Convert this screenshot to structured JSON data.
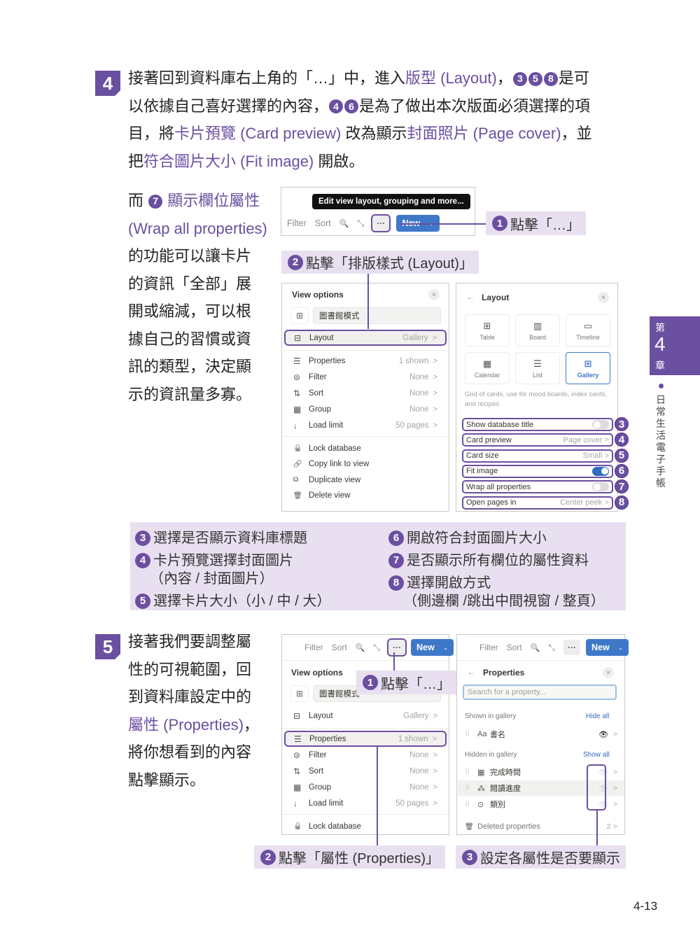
{
  "step4": {
    "badge": "4",
    "lines": [
      [
        {
          "t": "接著回到資料庫右上角的「…」中，進入"
        },
        {
          "t": "版型 (Layout)",
          "c": "purple"
        },
        {
          "t": "，"
        },
        {
          "n": "3"
        },
        {
          "n": "5"
        },
        {
          "n": "8"
        },
        {
          "t": "是可"
        }
      ],
      [
        {
          "t": "以依據自己喜好選擇的內容，"
        },
        {
          "n": "4"
        },
        {
          "n": "6"
        },
        {
          "t": "是為了做出本次版面必須選擇的項"
        }
      ],
      [
        {
          "t": "目，將"
        },
        {
          "t": "卡片預覽 (Card preview)",
          "c": "purple"
        },
        {
          "t": " 改為顯示"
        },
        {
          "t": "封面照片 (Page cover)",
          "c": "purple"
        },
        {
          "t": "，並"
        }
      ],
      [
        {
          "t": "把"
        },
        {
          "t": "符合圖片大小 (Fit image)",
          "c": "purple"
        },
        {
          "t": " 開啟。"
        }
      ]
    ]
  },
  "side_note": {
    "lines": [
      [
        {
          "t": "而 "
        },
        {
          "n": "7"
        },
        {
          "t": " 顯示欄位屬性",
          "c": "purple"
        }
      ],
      [
        {
          "t": "(Wrap all properties)",
          "c": "purple"
        }
      ],
      [
        {
          "t": "的功能可以讓卡片"
        }
      ],
      [
        {
          "t": "的資訊「全部」展"
        }
      ],
      [
        {
          "t": "開或縮減，可以根"
        }
      ],
      [
        {
          "t": "據自己的習慣或資"
        }
      ],
      [
        {
          "t": "訊的類型，決定顯"
        }
      ],
      [
        {
          "t": "示的資訊量多寡。"
        }
      ]
    ]
  },
  "toolbar": {
    "filter": "Filter",
    "sort": "Sort",
    "search_icon": "🔍",
    "expand_icon": "⤡",
    "more": "···",
    "new": "New",
    "new_chevron": "⌄",
    "tooltip": "Edit view layout, grouping and more..."
  },
  "callouts_top": {
    "c1": {
      "num": "1",
      "text": "點擊「…」"
    },
    "c2": {
      "num": "2",
      "text": "點擊「排版樣式 (Layout)」"
    }
  },
  "view_options": {
    "title": "View options",
    "close": "×",
    "view_name": "圖書館模式",
    "view_icon": "⊞",
    "items": [
      {
        "icon": "⊟",
        "label": "Layout",
        "value": "Gallery"
      },
      {
        "icon": "☰",
        "label": "Properties",
        "value": "1 shown"
      },
      {
        "icon": "⊜",
        "label": "Filter",
        "value": "None"
      },
      {
        "icon": "⇅",
        "label": "Sort",
        "value": "None"
      },
      {
        "icon": "▦",
        "label": "Group",
        "value": "None"
      },
      {
        "icon": "↓",
        "label": "Load limit",
        "value": "50 pages"
      }
    ],
    "actions": [
      {
        "icon": "🔒",
        "label": "Lock database"
      },
      {
        "icon": "🔗",
        "label": "Copy link to view"
      },
      {
        "icon": "⧉",
        "label": "Duplicate view"
      },
      {
        "icon": "🗑",
        "label": "Delete view"
      }
    ],
    "arrow": ">"
  },
  "layout_panel": {
    "back": "←",
    "title": "Layout",
    "close": "×",
    "tiles": [
      {
        "icon": "⊞",
        "label": "Table"
      },
      {
        "icon": "▥",
        "label": "Board"
      },
      {
        "icon": "▭",
        "label": "Timeline"
      },
      {
        "icon": "▦",
        "label": "Calendar"
      },
      {
        "icon": "☰",
        "label": "List"
      },
      {
        "icon": "⊞",
        "label": "Gallery",
        "selected": true
      }
    ],
    "description": "Grid of cards, use for mood boards, index cards, and recipes",
    "options": [
      {
        "num": "3",
        "label": "Show database title",
        "type": "toggle",
        "on": false
      },
      {
        "num": "4",
        "label": "Card preview",
        "value": "Page cover"
      },
      {
        "num": "5",
        "label": "Card size",
        "value": "Small"
      },
      {
        "num": "6",
        "label": "Fit image",
        "type": "toggle",
        "on": true
      },
      {
        "num": "7",
        "label": "Wrap all properties",
        "type": "toggle",
        "on": false
      },
      {
        "num": "8",
        "label": "Open pages in",
        "value": "Center peek"
      }
    ]
  },
  "summary": {
    "left": [
      [
        {
          "n": "3"
        },
        {
          "t": "選擇是否顯示資料庫標題"
        }
      ],
      [
        {
          "n": "4"
        },
        {
          "t": "卡片預覽選擇封面圖片"
        }
      ],
      [
        {
          "t": "（內容 / 封面圖片）"
        }
      ],
      [
        {
          "n": "5"
        },
        {
          "t": "選擇卡片大小（小 / 中 / 大）"
        }
      ]
    ],
    "right": [
      [
        {
          "n": "6"
        },
        {
          "t": "開啟符合封面圖片大小"
        }
      ],
      [
        {
          "n": "7"
        },
        {
          "t": "是否顯示所有欄位的屬性資料"
        }
      ],
      [
        {
          "n": "8"
        },
        {
          "t": "選擇開啟方式"
        }
      ],
      [
        {
          "t": "（側邊欄 /跳出中間視窗 / 整頁）"
        }
      ]
    ]
  },
  "step5": {
    "badge": "5",
    "lines": [
      [
        {
          "t": "接著我們要調整屬"
        }
      ],
      [
        {
          "t": "性的可視範圍，回"
        }
      ],
      [
        {
          "t": "到資料庫設定中的"
        }
      ],
      [
        {
          "t": "屬性 (Properties)",
          "c": "purple"
        },
        {
          "t": "，"
        }
      ],
      [
        {
          "t": "將你想看到的內容"
        }
      ],
      [
        {
          "t": "點擊顯示。"
        }
      ]
    ]
  },
  "view_options_2": {
    "title": "View options",
    "view_name": "圖書館模式",
    "items": [
      {
        "icon": "⊟",
        "label": "Layout",
        "value": "Gallery"
      },
      {
        "icon": "☰",
        "label": "Properties",
        "value": "1 shown"
      },
      {
        "icon": "⊜",
        "label": "Filter",
        "value": "None"
      },
      {
        "icon": "⇅",
        "label": "Sort",
        "value": "None"
      },
      {
        "icon": "▦",
        "label": "Group",
        "value": "None"
      },
      {
        "icon": "↓",
        "label": "Load limit",
        "value": "50 pages"
      }
    ],
    "lock": {
      "icon": "🔒",
      "label": "Lock database"
    }
  },
  "properties_panel": {
    "back": "←",
    "title": "Properties",
    "close": "×",
    "search_placeholder": "Search for a property...",
    "shown_label": "Shown in gallery",
    "hide_all": "Hide all",
    "shown": [
      {
        "icon": "Aa",
        "label": "書名"
      }
    ],
    "hidden_label": "Hidden in gallery",
    "show_all": "Show all",
    "hidden": [
      {
        "icon": "▦",
        "label": "完成時間"
      },
      {
        "icon": "⁂",
        "label": "閱讀進度"
      },
      {
        "icon": "⊙",
        "label": "類別"
      }
    ],
    "deleted": {
      "icon": "🗑",
      "label": "Deleted properties",
      "count": "2"
    },
    "eye": "👁",
    "drag": "⠿",
    "arrow": ">"
  },
  "callouts_bottom": {
    "c1": {
      "num": "1",
      "text": "點擊「…」"
    },
    "c2": {
      "num": "2",
      "text": "點擊「屬性 (Properties)」"
    },
    "c3": {
      "num": "3",
      "text": "設定各屬性是否要顯示"
    }
  },
  "chapter": {
    "top": "第",
    "number": "4",
    "bottom": "章",
    "title": "日常生活電子手帳"
  },
  "page_number": "4-13",
  "colors": {
    "accent": "#6b4fa0",
    "callout_bg": "#e8e0f0",
    "notion_blue": "#3f78c9"
  }
}
